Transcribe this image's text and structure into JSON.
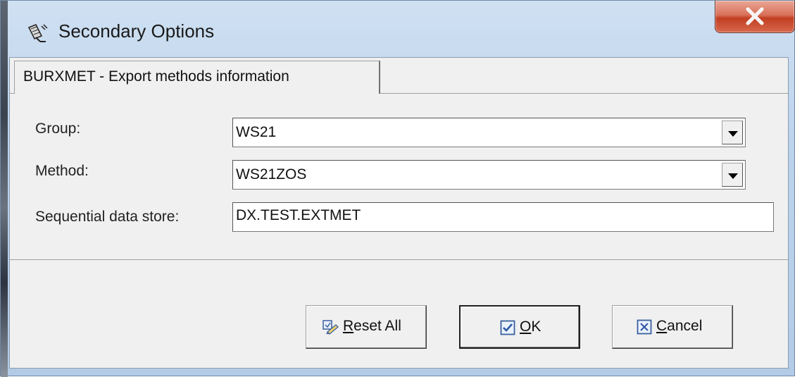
{
  "window": {
    "title": "Secondary Options",
    "app_icon": "satellite-dish-icon",
    "close_icon": "close-x-icon",
    "close_color": "#c74a2e"
  },
  "tabs": [
    {
      "label": "BURXMET - Export methods information",
      "selected": true
    }
  ],
  "form": {
    "group": {
      "label": "Group:",
      "value": "WS21"
    },
    "method": {
      "label": "Method:",
      "value": "WS21ZOS"
    },
    "sequential_data_store": {
      "label": "Sequential data store:",
      "value": "DX.TEST.EXTMET"
    }
  },
  "buttons": {
    "reset_all": {
      "mnemonic": "R",
      "rest": "eset All",
      "icon": "reset-icon"
    },
    "ok": {
      "mnemonic": "O",
      "rest": "K",
      "icon": "checkbox-checked-icon"
    },
    "cancel": {
      "mnemonic": "C",
      "rest": "ancel",
      "icon": "checkbox-x-icon"
    }
  }
}
